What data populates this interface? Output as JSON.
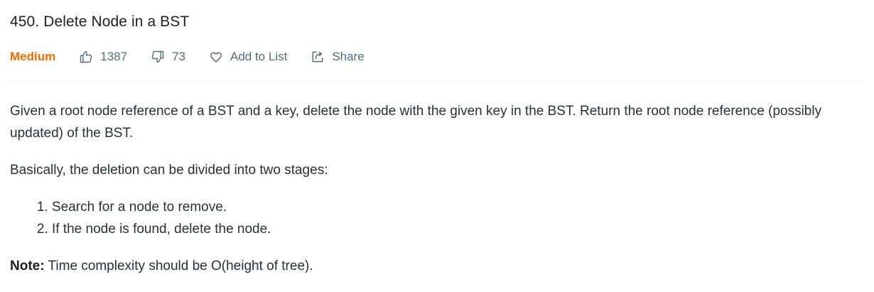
{
  "problem": {
    "title": "450. Delete Node in a BST",
    "difficulty": "Medium",
    "difficulty_color": "#ef6c00",
    "likes": "1387",
    "dislikes": "73",
    "add_to_list_label": "Add to List",
    "share_label": "Share",
    "icons": {
      "like": "thumbs-up-icon",
      "dislike": "thumbs-down-icon",
      "add_to_list": "heart-icon",
      "share": "share-icon"
    }
  },
  "description": {
    "paragraph1": "Given a root node reference of a BST and a key, delete the node with the given key in the BST. Return the root node reference (possibly updated) of the BST.",
    "paragraph2": "Basically, the deletion can be divided into two stages:",
    "steps": [
      "Search for a node to remove.",
      "If the node is found, delete the node."
    ],
    "note_label": "Note:",
    "note_text": " Time complexity should be O(height of tree)."
  }
}
